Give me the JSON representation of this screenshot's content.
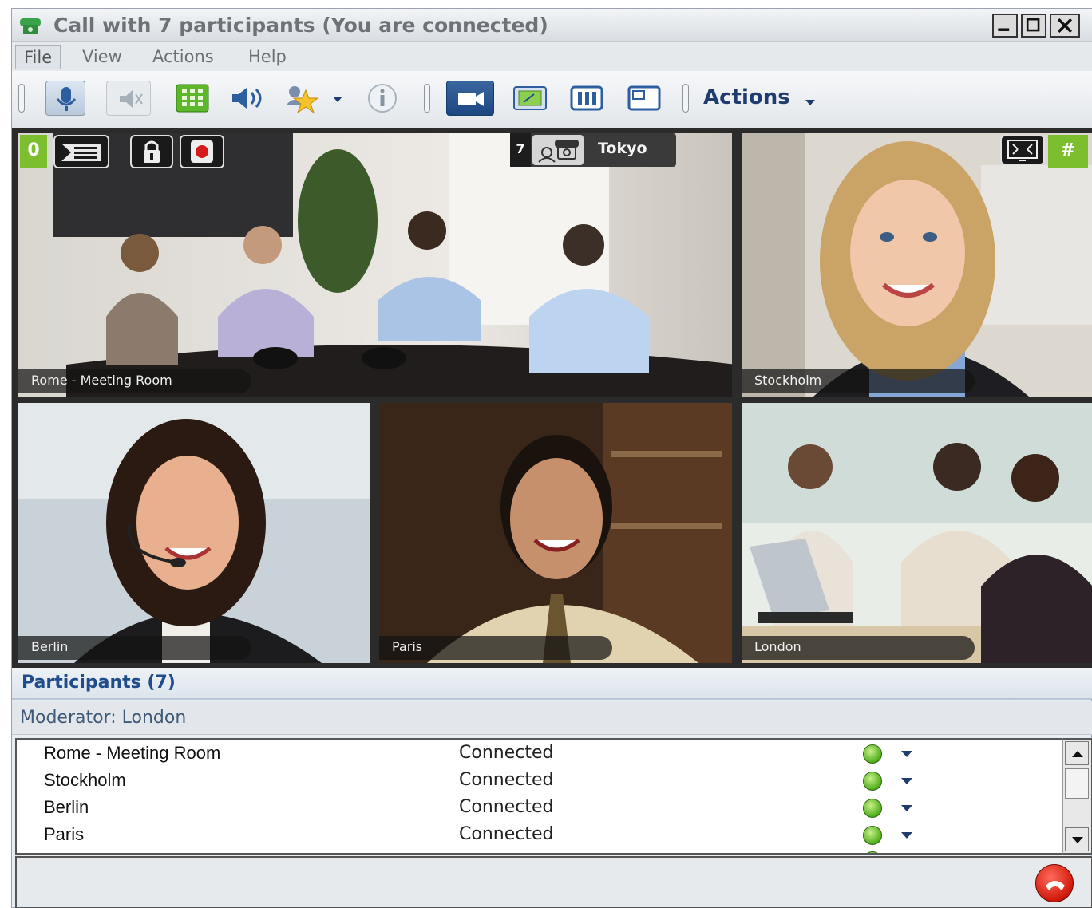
{
  "window": {
    "title": "Call with 7 participants (You are connected)",
    "controls": {
      "minimize": "minimize-icon",
      "maximize": "maximize-icon",
      "close": "close-icon"
    }
  },
  "menu": {
    "file": "File",
    "view": "View",
    "actions": "Actions",
    "help": "Help"
  },
  "toolbar": {
    "actions_label": "Actions",
    "icons": [
      "microphone-icon",
      "speaker-mute-icon",
      "dialpad-icon",
      "volume-icon",
      "favorites-star-icon",
      "info-icon",
      "camera-icon",
      "presentation-icon",
      "layout-icon",
      "window-icon"
    ]
  },
  "overlay": {
    "left_badge": "0",
    "right_badge": "#",
    "tokyo_count": "7",
    "tokyo_name": "Tokyo"
  },
  "videos": [
    {
      "label": "Rome - Meeting Room"
    },
    {
      "label": "Stockholm"
    },
    {
      "label": "Berlin"
    },
    {
      "label": "Paris"
    },
    {
      "label": "London"
    }
  ],
  "participants": {
    "title": "Participants (7)",
    "moderator": "Moderator:  London",
    "rows": [
      {
        "name": "Rome - Meeting Room",
        "status": "Connected"
      },
      {
        "name": "Stockholm",
        "status": "Connected"
      },
      {
        "name": "Berlin",
        "status": "Connected"
      },
      {
        "name": "Paris",
        "status": "Connected"
      }
    ]
  },
  "colors": {
    "accent": "#1f4c8a",
    "status_ok": "#4fae1a",
    "hangup": "#d41f10",
    "badge": "#7bbf2e"
  }
}
